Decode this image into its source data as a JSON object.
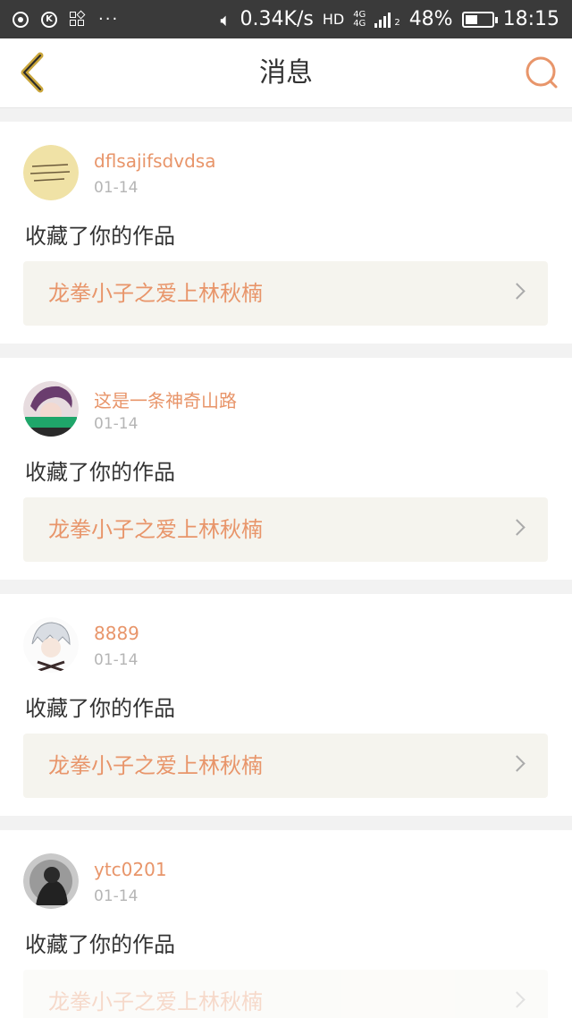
{
  "status_bar": {
    "speed": "0.34K/s",
    "network_hd": "HD",
    "network_4g_top": "4G",
    "network_4g_bottom": "4G",
    "sim_index": "2",
    "battery_percent": "48%",
    "battery_level": 0.48,
    "time": "18:15"
  },
  "header": {
    "title": "消息",
    "accent_color": "#e8956a",
    "back_color": "#c9a53a"
  },
  "messages": [
    {
      "user": "dflsajifsdvdsa",
      "date": "01-14",
      "action": "收藏了你的作品",
      "work_title": "龙拳小子之爱上林秋楠",
      "avatar": "yellow-text-avatar"
    },
    {
      "user": "这是一条神奇山路",
      "date": "01-14",
      "action": "收藏了你的作品",
      "work_title": "龙拳小子之爱上林秋楠",
      "avatar": "purple-hair-avatar"
    },
    {
      "user": "8889",
      "date": "01-14",
      "action": "收藏了你的作品",
      "work_title": "龙拳小子之爱上林秋楠",
      "avatar": "white-hair-avatar"
    },
    {
      "user": "ytc0201",
      "date": "01-14",
      "action": "收藏了你的作品",
      "work_title": "龙拳小子之爱上林秋楠",
      "avatar": "dark-photo-avatar"
    }
  ]
}
